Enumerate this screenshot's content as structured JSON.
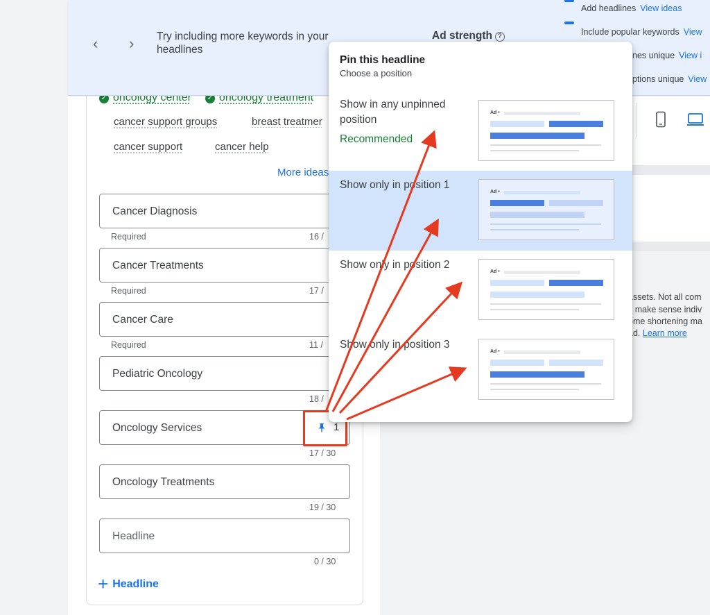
{
  "banner": {
    "prev_label": "‹",
    "next_label": "›",
    "tip": "Try including more keywords in your headlines",
    "ad_strength": "Ad strength",
    "help_label": "?",
    "suggestions": [
      {
        "text": "Add headlines",
        "link": "View ideas"
      },
      {
        "text": "Include popular keywords",
        "link": "View"
      },
      {
        "text": "nes unique",
        "link": "View i"
      },
      {
        "text": "ptions unique",
        "link": "View"
      }
    ]
  },
  "keywords": {
    "added": [
      "oncology center",
      "oncology treatment"
    ],
    "row1": [
      "cancer support groups",
      "breast treatmer"
    ],
    "row2": [
      "cancer support",
      "cancer help"
    ],
    "more_ideas": "More ideas"
  },
  "headlines": [
    {
      "text": "Cancer Diagnosis",
      "helper": "Required",
      "count": "16 /"
    },
    {
      "text": "Cancer Treatments",
      "helper": "Required",
      "count": "17 /"
    },
    {
      "text": "Cancer Care",
      "helper": "Required",
      "count": "11 /"
    },
    {
      "text": "Pediatric Oncology",
      "helper": "",
      "count": "18 /"
    },
    {
      "text": "Oncology Services",
      "helper": "",
      "count": "17 / 30",
      "pin": "1"
    },
    {
      "text": "Oncology Treatments",
      "helper": "",
      "count": "19 / 30"
    },
    {
      "text": "Headline",
      "helper": "",
      "count": "0 / 30",
      "placeholder": true
    }
  ],
  "add_headline": {
    "plus": "+",
    "label": "Headline"
  },
  "popup": {
    "title": "Pin this headline",
    "subtitle": "Choose a position",
    "options": [
      {
        "label": "Show in any unpinned position",
        "note": "Recommended",
        "selected": false
      },
      {
        "label": "Show only in position 1",
        "note": "",
        "selected": true
      },
      {
        "label": "Show only in position 2",
        "note": "",
        "selected": false
      },
      {
        "label": "Show only in position 3",
        "note": "",
        "selected": false
      }
    ],
    "thumb_ad_label": "Ad •"
  },
  "right_notes": [
    {
      "text": "assets. Not all com"
    },
    {
      "text": "y make sense indiv"
    },
    {
      "text": "ome shortening ma"
    },
    {
      "text": "ad.",
      "link": "Learn more"
    }
  ],
  "colors": {
    "accent": "#1a73e8",
    "selected_bg": "#d2e3fc",
    "success": "#188038",
    "annotation_red": "#e53a1f",
    "banner_bg": "#e8f0fe"
  },
  "icons": {
    "prev": "chevron-left-icon",
    "next": "chevron-right-icon",
    "help": "help-circle-icon",
    "check": "check-circle-icon",
    "pin": "pin-icon",
    "mobile": "mobile-device-icon",
    "desktop": "desktop-device-icon",
    "add": "plus-icon"
  }
}
